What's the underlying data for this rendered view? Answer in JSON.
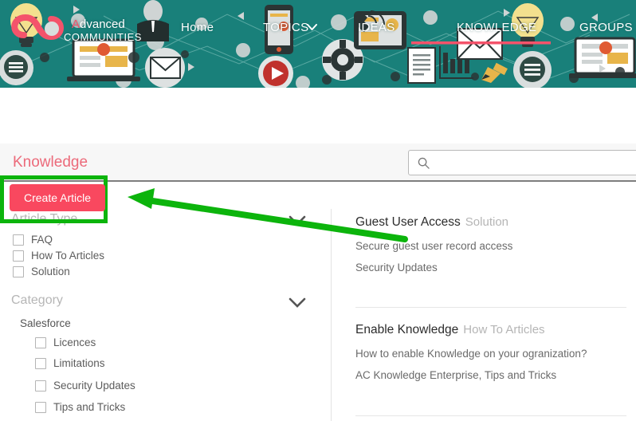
{
  "colors": {
    "banner_teal": "#19807A",
    "accent_pink": "#F9485F",
    "title_pink": "#EC6A7A",
    "annotation_green": "#0CB40C"
  },
  "header": {
    "logo": {
      "brand_lead": "A",
      "brand_rest": "dvanced",
      "brand_sub": "COMMUNITIES"
    },
    "nav": [
      {
        "id": "home",
        "label": "Home"
      },
      {
        "id": "topics",
        "label": "TOPICS"
      },
      {
        "id": "ideas",
        "label": "IDEAS"
      },
      {
        "id": "knowledge",
        "label": "KNOWLEDGE"
      },
      {
        "id": "groups",
        "label": "GROUPS"
      }
    ]
  },
  "toolbar": {
    "create_article_label": "Create Article"
  },
  "strip": {
    "page_title": "Knowledge"
  },
  "search": {
    "value": "",
    "placeholder": ""
  },
  "facets": [
    {
      "id": "article-type",
      "heading": "Article Type",
      "options": [
        {
          "label": "FAQ",
          "checked": false
        },
        {
          "label": "How To Articles",
          "checked": false
        },
        {
          "label": "Solution",
          "checked": false
        }
      ]
    },
    {
      "id": "category",
      "heading": "Category",
      "group_label": "Salesforce",
      "options": [
        {
          "label": "Licences",
          "checked": false
        },
        {
          "label": "Limitations",
          "checked": false
        },
        {
          "label": "Security Updates",
          "checked": false
        },
        {
          "label": "Tips and Tricks",
          "checked": false
        }
      ]
    }
  ],
  "articles": [
    {
      "title": "Guest User Access",
      "type": "Solution",
      "description": "Secure guest user record access",
      "category": "Security Updates"
    },
    {
      "title": "Enable Knowledge",
      "type": "How To Articles",
      "description": "How to enable Knowledge on your ogranization?",
      "category": "AC Knowledge Enterprise, Tips and Tricks"
    }
  ]
}
